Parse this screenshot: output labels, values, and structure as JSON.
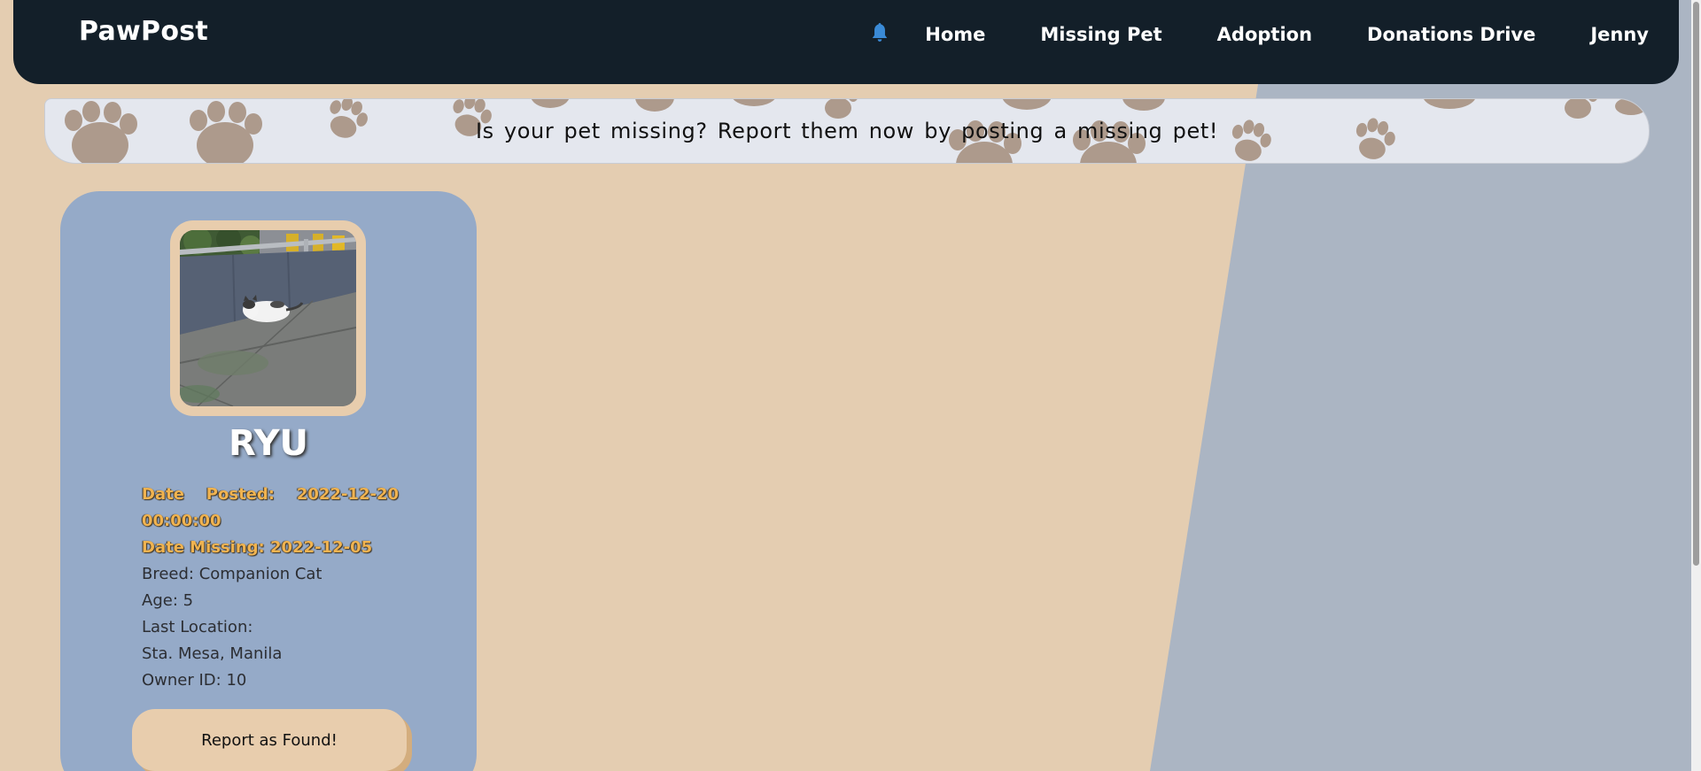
{
  "app": {
    "brand": "PawPost"
  },
  "nav": {
    "bell_icon": "bell-icon",
    "items": [
      {
        "label": "Home"
      },
      {
        "label": "Missing Pet"
      },
      {
        "label": "Adoption"
      },
      {
        "label": "Donations Drive"
      },
      {
        "label": "Jenny"
      }
    ]
  },
  "banner": {
    "text": "Is your pet missing? Report them now by posting a missing pet!",
    "icon": "paw-print-icon"
  },
  "pet": {
    "name": "RYU",
    "date_posted_label_1": "Date",
    "date_posted_label_2": "Posted:",
    "date_posted_value_1": "2022-12-20",
    "date_posted_value_2": "00:00:00",
    "date_missing": "Date Missing: 2022-12-05",
    "breed": "Breed: Companion Cat",
    "age": "Age: 5",
    "last_location_label": "Last Location:",
    "last_location_value": "Sta. Mesa, Manila",
    "owner_id": "Owner ID: 10",
    "report_button": "Report as Found!"
  },
  "colors": {
    "navbar": "#131f29",
    "page_bg": "#e4cdb1",
    "slant_bg": "#abb5c3",
    "card_bg": "#95aac8",
    "accent_button": "#e8cdad",
    "warn_text": "#f0b350",
    "bell": "#3a8ad6",
    "paw": "#ad9a8c"
  }
}
